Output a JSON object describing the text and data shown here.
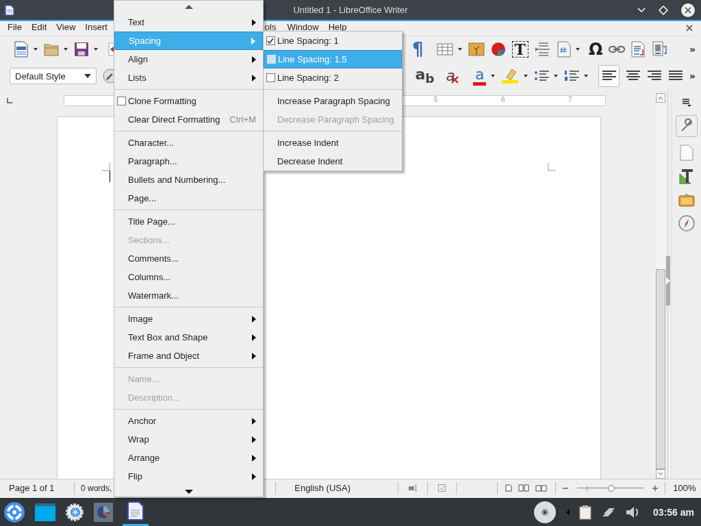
{
  "window": {
    "title": "Untitled 1 - LibreOffice Writer"
  },
  "menu_bar": [
    "File",
    "Edit",
    "View",
    "Insert",
    "ols",
    "Window",
    "Help"
  ],
  "toolbar_1": {
    "glyph_buttons": [
      "¶",
      "T",
      "Ω"
    ],
    "overflow": "»"
  },
  "toolbar_2": {
    "paragraph_style": "Default Style",
    "glyph_buttons": [
      "a$_{b}$",
      "a",
      "a"
    ],
    "overflow": "»"
  },
  "ruler": {
    "numbers": [
      "5",
      "6",
      "7"
    ]
  },
  "format_menu": {
    "items": [
      {
        "kind": "submenu",
        "label": "Text",
        "selected": false,
        "disabled": false
      },
      {
        "kind": "submenu",
        "label": "Spacing",
        "selected": true,
        "disabled": false
      },
      {
        "kind": "submenu",
        "label": "Align",
        "selected": false,
        "disabled": false
      },
      {
        "kind": "submenu",
        "label": "Lists",
        "selected": false,
        "disabled": false
      },
      {
        "kind": "separator"
      },
      {
        "kind": "check",
        "label": "Clone Formatting",
        "checked": false,
        "selected": false,
        "disabled": false
      },
      {
        "kind": "item",
        "label": "Clear Direct Formatting",
        "shortcut": "Ctrl+M",
        "selected": false,
        "disabled": false
      },
      {
        "kind": "separator"
      },
      {
        "kind": "item",
        "label": "Character...",
        "selected": false,
        "disabled": false
      },
      {
        "kind": "item",
        "label": "Paragraph...",
        "selected": false,
        "disabled": false
      },
      {
        "kind": "item",
        "label": "Bullets and Numbering...",
        "selected": false,
        "disabled": false
      },
      {
        "kind": "item",
        "label": "Page...",
        "selected": false,
        "disabled": false
      },
      {
        "kind": "separator"
      },
      {
        "kind": "item",
        "label": "Title Page...",
        "selected": false,
        "disabled": false
      },
      {
        "kind": "item",
        "label": "Sections...",
        "selected": false,
        "disabled": true
      },
      {
        "kind": "item",
        "label": "Comments...",
        "selected": false,
        "disabled": false
      },
      {
        "kind": "item",
        "label": "Columns...",
        "selected": false,
        "disabled": false
      },
      {
        "kind": "item",
        "label": "Watermark...",
        "selected": false,
        "disabled": false
      },
      {
        "kind": "separator"
      },
      {
        "kind": "submenu",
        "label": "Image",
        "selected": false,
        "disabled": false
      },
      {
        "kind": "submenu",
        "label": "Text Box and Shape",
        "selected": false,
        "disabled": false
      },
      {
        "kind": "submenu",
        "label": "Frame and Object",
        "selected": false,
        "disabled": false
      },
      {
        "kind": "separator"
      },
      {
        "kind": "item",
        "label": "Name...",
        "selected": false,
        "disabled": true
      },
      {
        "kind": "item",
        "label": "Description...",
        "selected": false,
        "disabled": true
      },
      {
        "kind": "separator"
      },
      {
        "kind": "submenu",
        "label": "Anchor",
        "selected": false,
        "disabled": false
      },
      {
        "kind": "submenu",
        "label": "Wrap",
        "selected": false,
        "disabled": false
      },
      {
        "kind": "submenu",
        "label": "Arrange",
        "selected": false,
        "disabled": false
      },
      {
        "kind": "submenu",
        "label": "Flip",
        "selected": false,
        "disabled": false
      }
    ]
  },
  "spacing_submenu": {
    "items": [
      {
        "kind": "check",
        "label": "Line Spacing: 1",
        "checked": true,
        "selected": false,
        "disabled": false
      },
      {
        "kind": "check",
        "label": "Line Spacing: 1.5",
        "checked": false,
        "selected": true,
        "disabled": false
      },
      {
        "kind": "check",
        "label": "Line Spacing: 2",
        "checked": false,
        "selected": false,
        "disabled": false
      },
      {
        "kind": "separator"
      },
      {
        "kind": "item",
        "label": "Increase Paragraph Spacing",
        "selected": false,
        "disabled": false
      },
      {
        "kind": "item",
        "label": "Decrease Paragraph Spacing",
        "selected": false,
        "disabled": true
      },
      {
        "kind": "separator"
      },
      {
        "kind": "item",
        "label": "Increase Indent",
        "selected": false,
        "disabled": false
      },
      {
        "kind": "item",
        "label": "Decrease Indent",
        "selected": false,
        "disabled": false
      }
    ]
  },
  "status_bar": {
    "page": "Page 1 of 1",
    "words": "0 words,",
    "language": "English (USA)",
    "zoom": {
      "level": 0.5,
      "reading": "100%"
    }
  },
  "taskbar": {
    "clock": "03:56 am"
  }
}
